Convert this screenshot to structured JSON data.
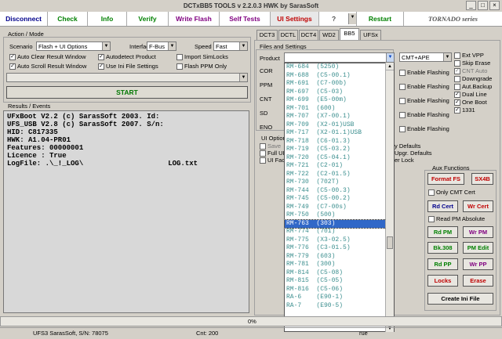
{
  "window": {
    "title": "DCTxBB5 TOOLS v 2.2.0.3 HWK by SarasSoft",
    "min": "_",
    "max": "□",
    "close": "×"
  },
  "toolbar": {
    "disconnect": "Disconnect",
    "check": "Check",
    "info": "Info",
    "verify": "Verify",
    "write_flash": "Write Flash",
    "self_tests": "Self Tests",
    "ui_settings": "UI Settings",
    "help": "?",
    "restart": "Restart",
    "brand": "TORNADO series",
    "colors": {
      "disconnect": "#00008b",
      "check": "#008000",
      "info": "#008000",
      "verify": "#008000",
      "write_flash": "#800080",
      "self_tests": "#800080",
      "ui_settings": "#c00000",
      "restart": "#008000"
    }
  },
  "action": {
    "group_label": "Action / Mode",
    "scenario_label": "Scenario",
    "scenario_value": "Flash + UI Options",
    "interface_label": "Interface",
    "interface_value": "F-Bus",
    "speed_label": "Speed",
    "speed_value": "Fast",
    "auto_clear": "Auto Clear Result Window",
    "auto_scroll": "Auto Scroll Result Window",
    "autodetect": "Autodetect Product",
    "use_ini": "Use Ini File Settings",
    "import_simlocks": "Import SimLocks",
    "flash_ppm_only": "Flash PPM Only",
    "start": "START"
  },
  "results": {
    "label": "Results / Events",
    "lines": [
      "UFxBoot V2.2 (c) SarasSoft 2003. Id:",
      "UFS_USB V2.8 (c) SarasSoft 2007. S/n:",
      "HID: C817335",
      "HWK: A1.04-PR01",
      "Features: 00000001",
      "Licence : True",
      "LogFile: .\\_!_LOG\\                    LOG.txt"
    ]
  },
  "tabs": [
    "DCT3",
    "DCTL",
    "DCT4",
    "WD2",
    "BB5",
    "UFSx"
  ],
  "files": {
    "group_label": "Files and Settings",
    "product_label": "Product",
    "mode_value": "CMT+APE",
    "rows": [
      "COR",
      "PPM",
      "CNT",
      "SD",
      "ENO"
    ],
    "enable_flashing": "Enable Flashing",
    "ui_options": "UI Option",
    "save": "Save",
    "full": "Full UI",
    "factory": "UI Fac",
    "defaults": "y Defaults",
    "upgr": "Upgr. Defaults",
    "lock": "er Lock"
  },
  "right_opts": [
    "Ext VPP",
    "Skip Erase",
    "CNT Auto",
    "Downgrade",
    "Aut.Backup",
    "Dual Line",
    "One Boot",
    "1331"
  ],
  "right_checked": [
    false,
    false,
    true,
    false,
    false,
    true,
    true,
    true
  ],
  "products": [
    "RM-684  (5250)",
    "RM-688  (C5-00.1)",
    "RM-691  (C7-00b)",
    "RM-697  (C5-03)",
    "RM-699  (E5-00m)",
    "RM-701  (600)",
    "RM-707  (X7-00.1)",
    "RM-709  (X2-01)USB",
    "RM-717  (X2-01.1)USB",
    "RM-718  (C6-01.3)",
    "RM-719  (C5-03.2)",
    "RM-720  (C5-04.1)",
    "RM-721  (C2-01)",
    "RM-722  (C2-01.5)",
    "RM-730  (702T)",
    "RM-744  (C5-00.3)",
    "RM-745  (C5-00.2)",
    "RM-749  (C7-00s)",
    "RM-750  (500)",
    "RM-763  (303)",
    "RM-774  (701)",
    "RM-775  (X3-02.5)",
    "RM-776  (C3-01.5)",
    "RM-779  (603)",
    "RM-781  (300)",
    "RM-814  (C5-08)",
    "RM-815  (C5-05)",
    "RM-816  (C5-06)",
    "RA-6    (E90-1)",
    "RA-7    (E90-5)"
  ],
  "selected_index": 19,
  "aux": {
    "label": "Aux Functions",
    "format_fs": "Format FS",
    "sx4b": "SX4B",
    "only_cmt": "Only CMT Cert",
    "rd_cert": "Rd Cert",
    "wr_cert": "Wr Cert",
    "read_pm_abs": "Read PM Absolute",
    "rd_pm": "Rd PM",
    "wr_pm": "Wr PM",
    "bk308": "Bk.308",
    "pm_edit": "PM Edit",
    "rd_pp": "Rd PP",
    "wr_pp": "Wr PP",
    "locks": "Locks",
    "erase": "Erase",
    "create_ini": "Create Ini File"
  },
  "status": {
    "progress": "0%",
    "left": "UFS3 SarasSoft, S/N: 78075",
    "cnt": "Cnt: 200",
    "right": "rue"
  }
}
